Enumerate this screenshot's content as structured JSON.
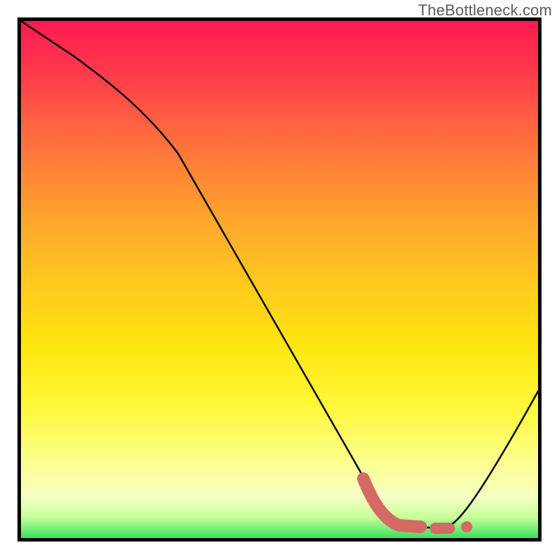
{
  "watermark": "TheBottleneck.com",
  "chart_data": {
    "type": "line",
    "title": "",
    "xlabel": "",
    "ylabel": "",
    "xlim": [
      0,
      100
    ],
    "ylim": [
      0,
      100
    ],
    "grid": false,
    "legend": false,
    "series": [
      {
        "name": "curve",
        "x": [
          0,
          10,
          20,
          30,
          40,
          50,
          60,
          68,
          72,
          76,
          80,
          85,
          100
        ],
        "y": [
          100,
          93,
          85,
          74,
          57,
          40,
          24,
          8,
          2,
          0,
          0,
          2,
          30
        ],
        "style": "thin-black"
      },
      {
        "name": "optimal-region",
        "x": [
          65,
          68,
          72,
          76
        ],
        "y": [
          12,
          4,
          1,
          0
        ],
        "style": "thick-salmon"
      }
    ],
    "annotations": {
      "background": "vertical-rainbow-gradient",
      "optimal_markers": {
        "dash_x": 80,
        "dot_x": 85
      }
    }
  }
}
